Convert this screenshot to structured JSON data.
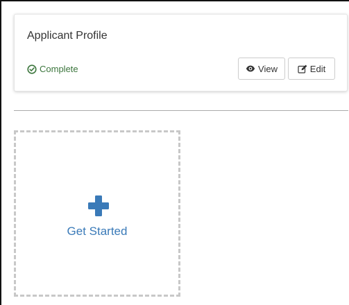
{
  "profile_card": {
    "title": "Applicant Profile",
    "status": {
      "label": "Complete",
      "icon": "check-circle-icon",
      "color": "#3c763d"
    },
    "actions": [
      {
        "label": "View",
        "icon": "eye-icon"
      },
      {
        "label": "Edit",
        "icon": "edit-icon"
      }
    ]
  },
  "get_started": {
    "label": "Get Started",
    "icon": "plus-icon",
    "accent": "#3a7ab8"
  }
}
